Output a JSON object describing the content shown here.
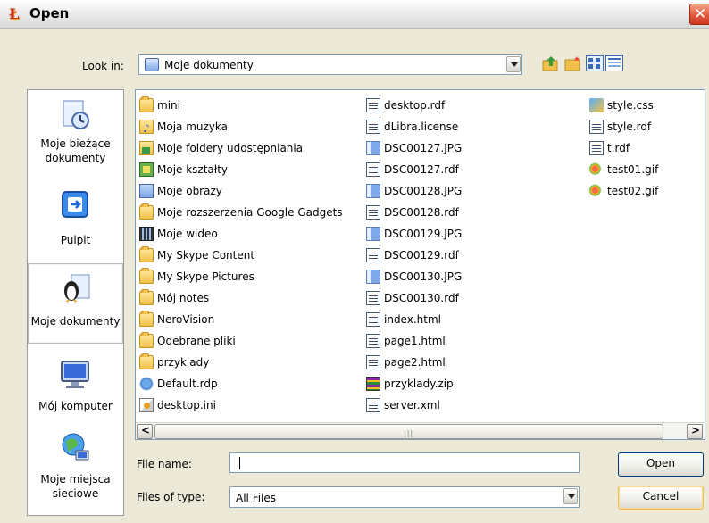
{
  "window": {
    "title": "Open",
    "close_label": "✕"
  },
  "lookin": {
    "label": "Look in:",
    "value": "Moje dokumenty"
  },
  "places": [
    {
      "label": "Moje bieżące dokumenty",
      "icon": "recent-docs-icon"
    },
    {
      "label": "Pulpit",
      "icon": "desktop-icon"
    },
    {
      "label": "Moje dokumenty",
      "icon": "my-documents-icon",
      "selected": true
    },
    {
      "label": "Mój komputer",
      "icon": "my-computer-icon"
    },
    {
      "label": "Moje miejsca sieciowe",
      "icon": "network-places-icon"
    }
  ],
  "files": {
    "col1": [
      {
        "name": "mini",
        "type": "folder"
      },
      {
        "name": "Moja muzyka",
        "type": "music"
      },
      {
        "name": "Moje foldery udostępniania",
        "type": "share"
      },
      {
        "name": "Moje kształty",
        "type": "shapes"
      },
      {
        "name": "Moje obrazy",
        "type": "pics"
      },
      {
        "name": "Moje rozszerzenia Google Gadgets",
        "type": "folder"
      },
      {
        "name": "Moje wideo",
        "type": "video"
      },
      {
        "name": "My Skype Content",
        "type": "folder"
      },
      {
        "name": "My Skype Pictures",
        "type": "folder"
      },
      {
        "name": "Mój notes",
        "type": "folder"
      },
      {
        "name": "NeroVision",
        "type": "folder"
      },
      {
        "name": "Odebrane pliki",
        "type": "folder"
      },
      {
        "name": "przyklady",
        "type": "folder"
      },
      {
        "name": "Default.rdp",
        "type": "rdp"
      },
      {
        "name": "desktop.ini",
        "type": "ini"
      }
    ],
    "col2": [
      {
        "name": "desktop.rdf",
        "type": "rdf"
      },
      {
        "name": "dLibra.license",
        "type": "rdf"
      },
      {
        "name": "DSC00127.JPG",
        "type": "img"
      },
      {
        "name": "DSC00127.rdf",
        "type": "rdf"
      },
      {
        "name": "DSC00128.JPG",
        "type": "img"
      },
      {
        "name": "DSC00128.rdf",
        "type": "rdf"
      },
      {
        "name": "DSC00129.JPG",
        "type": "img"
      },
      {
        "name": "DSC00129.rdf",
        "type": "rdf"
      },
      {
        "name": "DSC00130.JPG",
        "type": "img"
      },
      {
        "name": "DSC00130.rdf",
        "type": "rdf"
      },
      {
        "name": "index.html",
        "type": "rdf"
      },
      {
        "name": "page1.html",
        "type": "rdf"
      },
      {
        "name": "page2.html",
        "type": "rdf"
      },
      {
        "name": "przyklady.zip",
        "type": "zip"
      },
      {
        "name": "server.xml",
        "type": "rdf"
      }
    ],
    "col3": [
      {
        "name": "style.css",
        "type": "css"
      },
      {
        "name": "style.rdf",
        "type": "rdf"
      },
      {
        "name": "t.rdf",
        "type": "rdf"
      },
      {
        "name": "test01.gif",
        "type": "gif"
      },
      {
        "name": "test02.gif",
        "type": "gif"
      }
    ]
  },
  "scroll": {
    "left_arrow": "<",
    "right_arrow": ">",
    "grip": "|||"
  },
  "filename": {
    "label": "File name:",
    "value": ""
  },
  "filetype": {
    "label": "Files of type:",
    "value": "All Files"
  },
  "buttons": {
    "open": "Open",
    "cancel": "Cancel"
  }
}
